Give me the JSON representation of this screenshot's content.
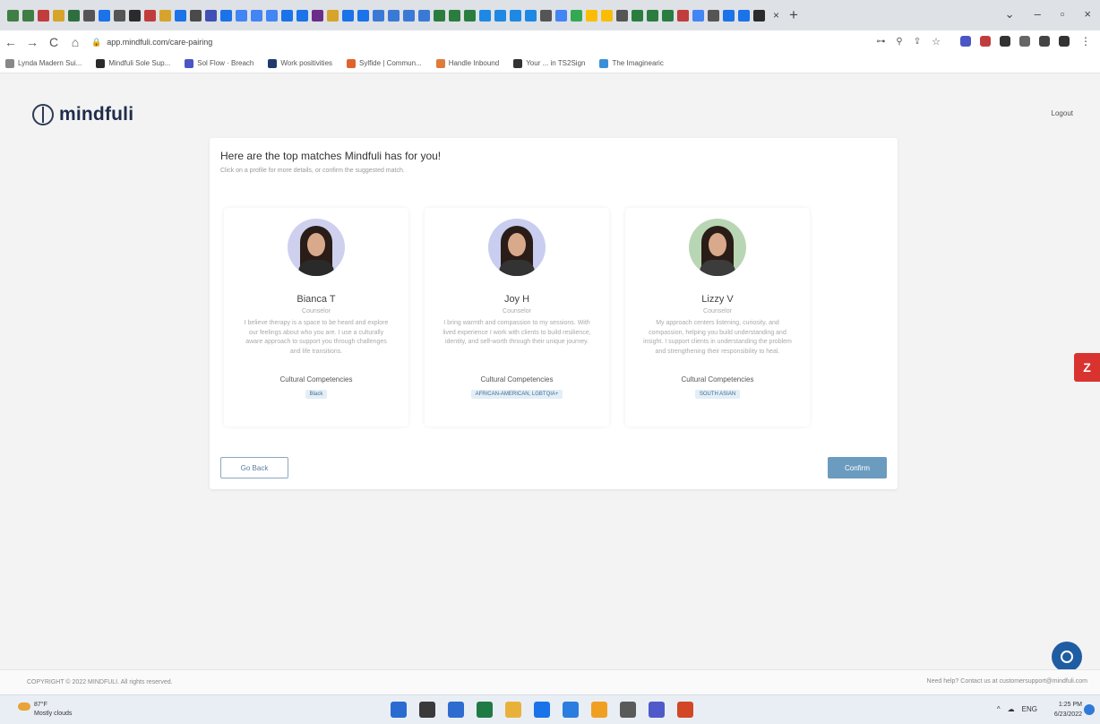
{
  "browser": {
    "tab_icon_colors": [
      "#3f7e44",
      "#3f7e44",
      "#c13d3d",
      "#d6a42b",
      "#2f6f3f",
      "#555555",
      "#1a73e8",
      "#555555",
      "#2b2b2b",
      "#c13d3d",
      "#d6a42b",
      "#1a73e8",
      "#4a4a4a",
      "#3f51b5",
      "#1a73e8",
      "#4285f4",
      "#4285f4",
      "#4285f4",
      "#1a73e8",
      "#1a73e8",
      "#6b2d8a",
      "#d6a42b",
      "#1a73e8",
      "#1a73e8",
      "#3a7ad6",
      "#3a7ad6",
      "#3a7ad6",
      "#3a7ad6",
      "#2a7d3e",
      "#2a7d3e",
      "#2a7d3e",
      "#1e88e5",
      "#1e88e5",
      "#1e88e5",
      "#1e88e5",
      "#555555",
      "#4285f4",
      "#34a853",
      "#fbbc05",
      "#fbbc05",
      "#555555",
      "#2a7d3e",
      "#2a7d3e",
      "#2a7d3e",
      "#c13d3d",
      "#4285f4",
      "#555555",
      "#1a73e8",
      "#1a73e8",
      "#2b2b2b"
    ],
    "tab_close": "×",
    "new_tab": "+",
    "window_controls": [
      "⌄",
      "–",
      "▫",
      "×"
    ],
    "nav": {
      "back": "←",
      "forward": "→",
      "reload": "C",
      "home": "⌂"
    },
    "url": "app.mindfuli.com/care-pairing",
    "lock": "🔒",
    "addr_right_icons": [
      "⊶",
      "⚲",
      "⇪",
      "☆"
    ],
    "ext_icon_colors": [
      "#4a56c6",
      "#c13d3d",
      "#333333",
      "#666666",
      "#444444",
      "#333333"
    ],
    "menu": "⋮",
    "bookmarks": [
      {
        "label": "Lynda Madern Sui...",
        "color": "#888888"
      },
      {
        "label": "Mindfuli Sole Sup...",
        "color": "#2b2b2b"
      },
      {
        "label": "Sol Flow · Breach",
        "color": "#4a56c6"
      },
      {
        "label": "Work positivities",
        "color": "#1f3b6e"
      },
      {
        "label": "Sylfide | Commun...",
        "color": "#e0632b"
      },
      {
        "label": "Handle Inbound",
        "color": "#e07b39"
      },
      {
        "label": "Your ... in TS2Sign",
        "color": "#333333"
      },
      {
        "label": "The Imaginearic",
        "color": "#3a8fd8"
      }
    ]
  },
  "app": {
    "logo_text": "mindfuli",
    "logout": "Logout",
    "title": "Here are the top matches Mindfuli has for you!",
    "subtitle": "Click on a profile for more details, or confirm the suggested match.",
    "back_button": "Go Back",
    "confirm_button": "Confirm",
    "side_tab": "Z",
    "therapists": [
      {
        "name": "Bianca T",
        "role": "Counselor",
        "bio": "I believe therapy is a space to be heard and explore our feelings about who you are. I use a culturally aware approach to support you through challenges and life transitions.",
        "label": "Cultural Competencies",
        "tag": "Black",
        "avatar_bg": "#cfd0ee",
        "avatar_shirt": "#2a2a2a"
      },
      {
        "name": "Joy H",
        "role": "Counselor",
        "bio": "I bring warmth and compassion to my sessions. With lived experience I work with clients to build resilience, identity, and self-worth through their unique journey.",
        "label": "Cultural Competencies",
        "tag": "AFRICAN-AMERICAN, LGBTQIA+",
        "avatar_bg": "#c9cdf0",
        "avatar_shirt": "#333333"
      },
      {
        "name": "Lizzy V",
        "role": "Counselor",
        "bio": "My approach centers listening, curiosity, and compassion, helping you build understanding and insight. I support clients in understanding the problem and strengthening their responsibility to heal.",
        "label": "Cultural Competencies",
        "tag": "SOUTH ASIAN",
        "avatar_bg": "#b9d6b4",
        "avatar_shirt": "#3c3c3c"
      }
    ],
    "footer_left": "COPYRIGHT © 2022 MINDFULI. All rights reserved.",
    "footer_right": "Need help? Contact us at customersupport@mindfuli.com"
  },
  "taskbar": {
    "temp": "87°F",
    "weather": "Mostly clouds",
    "icon_colors": [
      "#2a6bd1",
      "#3a3a3a",
      "#2f6ccf",
      "#1f7a44",
      "#e8b23a",
      "#1a73e8",
      "#2b7de0",
      "#f0a020",
      "#5a5a5a",
      "#5059c9",
      "#d24726"
    ],
    "tray": [
      "^",
      "☁",
      "ENG"
    ],
    "time": "1:25 PM",
    "date": "6/23/2022"
  }
}
